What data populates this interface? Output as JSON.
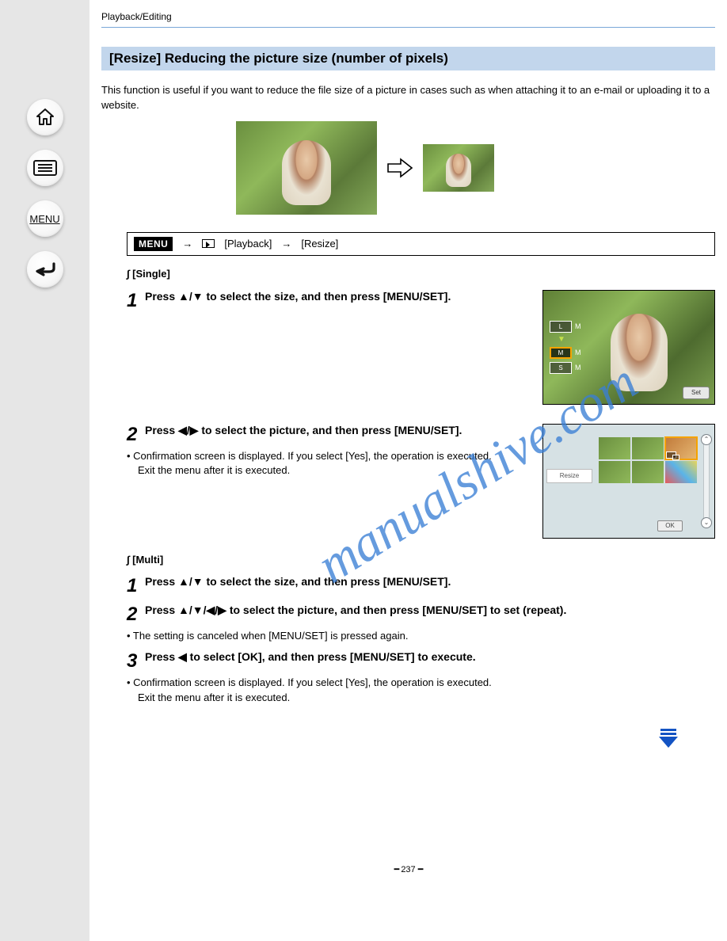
{
  "nav": {
    "home": "home-icon",
    "toc": "list-icon",
    "menu_label": "MENU",
    "back": "back-icon"
  },
  "header": {
    "topline": "Playback/Editing",
    "title": "[Resize]  Reducing the picture size (number of pixels)"
  },
  "intro": "This function is useful if you want to reduce the file size of a picture in cases such as when attaching it to an e-mail or uploading it to a website.",
  "menu_path": {
    "menu_chip": "MENU",
    "arrow": "→",
    "play": "play-icon",
    "category": "[Playback]",
    "item": "[Resize]"
  },
  "setting_header": "∫ [Single]",
  "steps": [
    {
      "num": "1",
      "title": "Press ▲/▼ to select the size, and then press [MENU/SET].",
      "body": ""
    },
    {
      "num": "2",
      "title": "Press ◀/▶ to select the picture, and then press [MENU/SET].",
      "bullets": [
        "• Confirmation screen is displayed. If you select [Yes], the operation is executed.",
        "Exit the menu after it is executed."
      ]
    }
  ],
  "setting_multi": {
    "header": "∫ [Multi]",
    "step1": {
      "num": "1",
      "title": "Press ▲/▼ to select the size, and then press [MENU/SET]."
    },
    "step2": {
      "num": "2",
      "title": "Press ▲/▼/◀/▶ to select the picture, and then press [MENU/SET] to set (repeat).",
      "bullets": [
        "• The setting is canceled when [MENU/SET] is pressed again."
      ]
    },
    "step3": {
      "num": "3",
      "title": "Press ◀ to select [OK], and then press [MENU/SET] to execute.",
      "bullets": [
        "• Confirmation screen is displayed. If you select [Yes], the operation is executed.",
        "Exit the menu after it is executed."
      ]
    }
  },
  "diag1": {
    "sizes": [
      "L",
      "M",
      "S"
    ],
    "size_m_suffix": "M",
    "set": "Set"
  },
  "diag2": {
    "label": "Resize",
    "ok": "OK"
  },
  "watermark": "manualshive.com",
  "page_number": "237"
}
